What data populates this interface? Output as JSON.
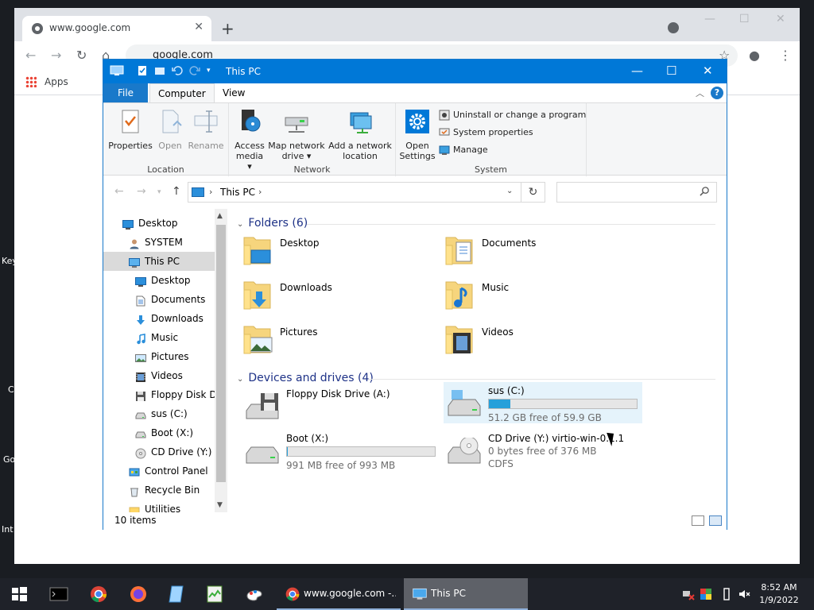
{
  "desktop": {
    "edge_labels": [
      "Key",
      "C",
      "Go",
      "Int"
    ]
  },
  "browser": {
    "tab_title": "www.google.com",
    "tab_close": "✕",
    "new_tab": "+",
    "url": "google.com",
    "bookmark_apps": "Apps",
    "min": "—",
    "max": "☐",
    "close": "✕"
  },
  "explorer": {
    "title": "This PC",
    "min": "—",
    "max": "☐",
    "close": "✕",
    "tabs": {
      "file": "File",
      "computer": "Computer",
      "view": "View"
    },
    "help": "?",
    "ribbon": {
      "location_label": "Location",
      "network_label": "Network",
      "system_label": "System",
      "properties": "Properties",
      "open": "Open",
      "rename": "Rename",
      "access_media_1": "Access",
      "access_media_2": "media ▾",
      "map_drive_1": "Map network",
      "map_drive_2": "drive ▾",
      "add_location_1": "Add a network",
      "add_location_2": "location",
      "open_settings_1": "Open",
      "open_settings_2": "Settings",
      "uninstall": "Uninstall or change a program",
      "system_properties": "System properties",
      "manage": "Manage"
    },
    "address": {
      "crumb": "This PC",
      "refresh": "↻",
      "search_placeholder": ""
    },
    "nav": [
      {
        "label": "Desktop",
        "indent": 1,
        "icon": "desktop-icon"
      },
      {
        "label": "SYSTEM",
        "indent": 2,
        "icon": "user-icon"
      },
      {
        "label": "This PC",
        "indent": 2,
        "icon": "computer-icon",
        "selected": true
      },
      {
        "label": "Desktop",
        "indent": 3,
        "icon": "desktop-icon"
      },
      {
        "label": "Documents",
        "indent": 3,
        "icon": "documents-icon"
      },
      {
        "label": "Downloads",
        "indent": 3,
        "icon": "downloads-icon"
      },
      {
        "label": "Music",
        "indent": 3,
        "icon": "music-icon"
      },
      {
        "label": "Pictures",
        "indent": 3,
        "icon": "pictures-icon"
      },
      {
        "label": "Videos",
        "indent": 3,
        "icon": "videos-icon"
      },
      {
        "label": "Floppy Disk Dri",
        "indent": 3,
        "icon": "floppy-icon"
      },
      {
        "label": "sus (C:)",
        "indent": 3,
        "icon": "drive-icon"
      },
      {
        "label": "Boot (X:)",
        "indent": 3,
        "icon": "drive-icon"
      },
      {
        "label": "CD Drive (Y:) vi",
        "indent": 3,
        "icon": "cd-icon"
      },
      {
        "label": "Control Panel",
        "indent": 2,
        "icon": "control-panel-icon"
      },
      {
        "label": "Recycle Bin",
        "indent": 2,
        "icon": "recycle-bin-icon"
      },
      {
        "label": "Utilities",
        "indent": 2,
        "icon": "folder-icon"
      }
    ],
    "folders_header": "Folders (6)",
    "folders": [
      "Desktop",
      "Documents",
      "Downloads",
      "Music",
      "Pictures",
      "Videos"
    ],
    "drives_header": "Devices and drives (4)",
    "drives": [
      {
        "name": "Floppy Disk Drive (A:)",
        "info": "",
        "used_fraction": null
      },
      {
        "name": "sus (C:)",
        "info": "51.2 GB free of 59.9 GB",
        "used_fraction": 0.145
      },
      {
        "name": "Boot (X:)",
        "info": "991 MB free of 993 MB",
        "used_fraction": 0.002
      },
      {
        "name": "CD Drive (Y:) virtio-win-0.1.1",
        "info": "0 bytes free of 376 MB",
        "info2": "CDFS",
        "used_fraction": null
      }
    ],
    "status": "10 items"
  },
  "taskbar": {
    "tasks": [
      {
        "label": "www.google.com -..."
      },
      {
        "label": "This PC"
      }
    ],
    "time": "8:52 AM",
    "date": "1/9/2022"
  },
  "colors": {
    "accent": "#0078d7",
    "drive_fill": "#26a0da",
    "taskbar": "#1f2229"
  }
}
